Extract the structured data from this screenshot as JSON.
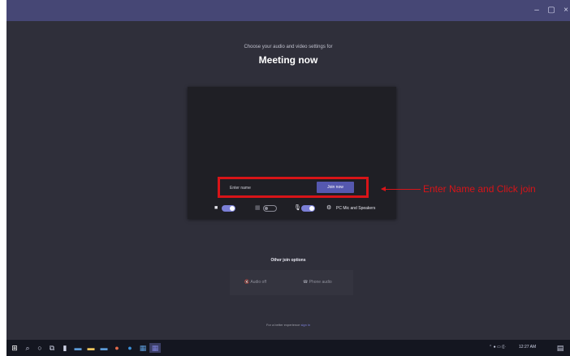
{
  "window": {
    "controls": {
      "minimize": "–",
      "maximize": "▢",
      "close": "×"
    }
  },
  "heading": {
    "subtitle": "Choose your audio and video settings for",
    "title": "Meeting now"
  },
  "join": {
    "name_placeholder": "Enter name",
    "button_label": "Join now"
  },
  "devices": {
    "camera": {
      "on": true
    },
    "blur": {
      "on": false
    },
    "microphone": {
      "on": true
    },
    "audio_device": "PC Mic and Speakers"
  },
  "annotation": {
    "text": "Enter Name and Click join",
    "color": "#d81418"
  },
  "other_join": {
    "title": "Other join options",
    "audio_off": "Audio off",
    "phone_audio": "Phone audio"
  },
  "footer": {
    "prefix": "For a better experience",
    "link": "sign in"
  },
  "taskbar": {
    "clock": "12:27 AM"
  },
  "colors": {
    "titlebar": "#464775",
    "background": "#2f2f3a",
    "accent": "#5558af"
  }
}
